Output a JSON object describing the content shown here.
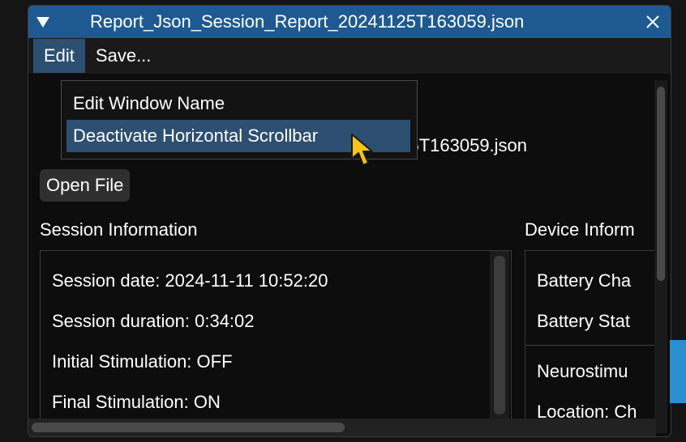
{
  "window": {
    "title": "Report_Json_Session_Report_20241125T163059.json",
    "icons": {
      "collapse": "triangle-down-icon",
      "close": "close-x-icon"
    }
  },
  "menubar": {
    "edit_label": "Edit",
    "save_label": "Save..."
  },
  "dropdown": {
    "items": [
      {
        "label": "Edit Window Name"
      },
      {
        "label": "Deactivate Horizontal Scrollbar"
      }
    ]
  },
  "file": {
    "partial_name": "125T163059.json",
    "open_button": "Open File"
  },
  "session": {
    "title": "Session Information",
    "rows": [
      "Session date: 2024-11-11 10:52:20",
      "Session duration: 0:34:02",
      "Initial Stimulation: OFF",
      "Final Stimulation: ON"
    ]
  },
  "device": {
    "title": "Device Inform",
    "rows": [
      "Battery Cha",
      "Battery Stat",
      "Neurostimu",
      "Location: Ch"
    ]
  },
  "colors": {
    "titlebar": "#1e5a91",
    "highlight": "#2c4f72",
    "cursor": "#f5c518"
  }
}
